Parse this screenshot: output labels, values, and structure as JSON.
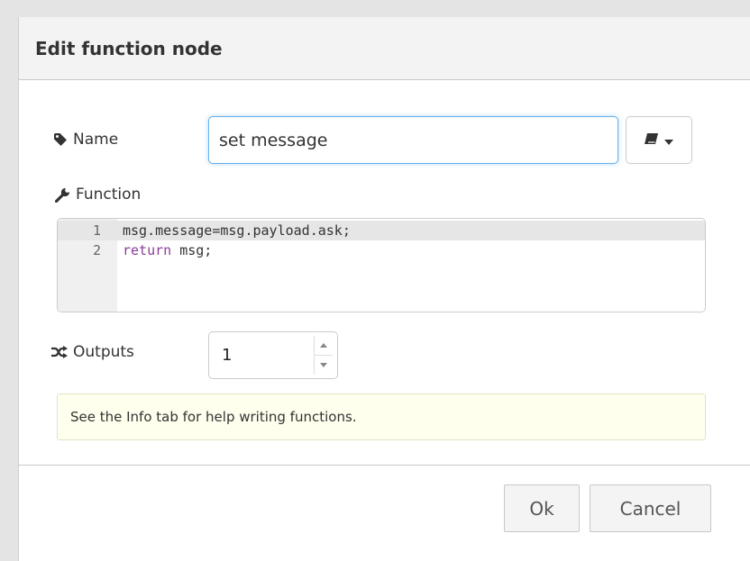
{
  "dialog": {
    "title": "Edit function node"
  },
  "name_row": {
    "label": "Name",
    "icon": "tag-icon",
    "value": "set message",
    "icon_select": {
      "icon": "book-icon",
      "caret": "caret-down-icon"
    }
  },
  "function_row": {
    "label": "Function",
    "icon": "wrench-icon",
    "lines": [
      {
        "number": "1",
        "text": "msg.message=msg.payload.ask;"
      },
      {
        "number": "2",
        "keyword": "return",
        "text": " msg;"
      }
    ]
  },
  "outputs_row": {
    "label": "Outputs",
    "icon": "random-icon",
    "value": "1"
  },
  "tip": {
    "text": "See the Info tab for help writing functions."
  },
  "footer": {
    "ok_label": "Ok",
    "cancel_label": "Cancel"
  },
  "colors": {
    "focus_border": "#66afe9",
    "tip_background": "#ffffee",
    "keyword": "#8a3d9c"
  }
}
